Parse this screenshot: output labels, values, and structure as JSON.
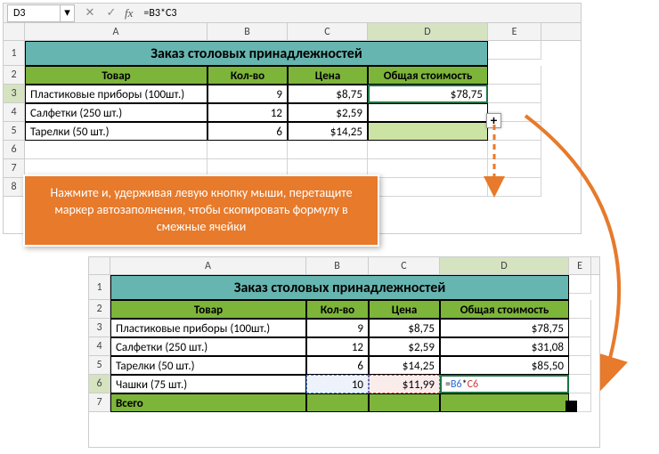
{
  "namebox": "D3",
  "formula": "=B3*C3",
  "fx_label": "fx",
  "btn_expand": "▾",
  "btn_cancel": "✕",
  "btn_confirm": "✓",
  "sheet1": {
    "cols": [
      "A",
      "B",
      "C",
      "D",
      "E"
    ],
    "rows": [
      "1",
      "2",
      "3",
      "4",
      "5",
      "6",
      "7",
      "8"
    ],
    "title": "Заказ столовых принадлежностей",
    "headers": {
      "item": "Товар",
      "qty": "Кол-во",
      "price": "Цена",
      "total": "Общая стоимость"
    },
    "data": [
      {
        "item": "Пластиковые приборы (100шт.)",
        "qty": "9",
        "price": "$8,75",
        "total": "$78,75"
      },
      {
        "item": "Салфетки (250 шт.)",
        "qty": "12",
        "price": "$2,59",
        "total": ""
      },
      {
        "item": "Тарелки (50 шт.)",
        "qty": "6",
        "price": "$14,25",
        "total": ""
      }
    ]
  },
  "callout_text": "Нажмите и, удерживая левую кнопку мыши, перетащите маркер автозаполнения, чтобы скопировать формулу в смежные ячейки",
  "plus_icon": "+",
  "sheet2": {
    "cols": [
      "A",
      "B",
      "C",
      "D",
      "E"
    ],
    "rows": [
      "1",
      "2",
      "3",
      "4",
      "5",
      "6",
      "7"
    ],
    "title": "Заказ столовых принадлежностей",
    "headers": {
      "item": "Товар",
      "qty": "Кол-во",
      "price": "Цена",
      "total": "Общая стоимость"
    },
    "data": [
      {
        "item": "Пластиковые приборы (100шт.)",
        "qty": "9",
        "price": "$8,75",
        "total": "$78,75"
      },
      {
        "item": "Салфетки (250 шт.)",
        "qty": "12",
        "price": "$2,59",
        "total": "$31,08"
      },
      {
        "item": "Тарелки (50 шт.)",
        "qty": "6",
        "price": "$14,25",
        "total": "$85,50"
      },
      {
        "item": "Чашки (75 шт.)",
        "qty": "10",
        "price": "$11,99",
        "total_formula": {
          "prefix": "=",
          "ref1": "B6",
          "op": "*",
          "ref2": "C6"
        }
      }
    ],
    "footer_label": "Всего"
  },
  "chart_data": {
    "type": "table",
    "title": "Заказ столовых принадлежностей",
    "columns": [
      "Товар",
      "Кол-во",
      "Цена",
      "Общая стоимость"
    ],
    "rows": [
      [
        "Пластиковые приборы (100шт.)",
        9,
        8.75,
        78.75
      ],
      [
        "Салфетки (250 шт.)",
        12,
        2.59,
        31.08
      ],
      [
        "Тарелки (50 шт.)",
        6,
        14.25,
        85.5
      ],
      [
        "Чашки (75 шт.)",
        10,
        11.99,
        null
      ]
    ],
    "currency": "$",
    "decimal_separator": ","
  }
}
